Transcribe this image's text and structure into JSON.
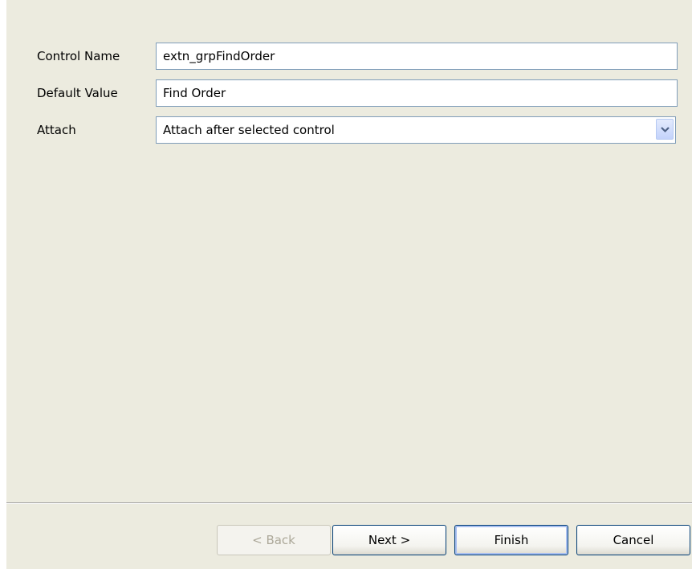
{
  "form": {
    "control_name": {
      "label": "Control Name",
      "value": "extn_grpFindOrder"
    },
    "default_value": {
      "label": "Default Value",
      "value": "Find Order"
    },
    "attach": {
      "label": "Attach",
      "selected": "Attach after selected control",
      "arrow_icon": "chevron-down-icon"
    }
  },
  "buttons": {
    "back": "< Back",
    "next": "Next >",
    "finish": "Finish",
    "cancel": "Cancel"
  },
  "colors": {
    "dialog_background": "#ecebdf",
    "field_border": "#7f9db9",
    "button_border": "#003c74",
    "disabled_text": "#aca899"
  }
}
